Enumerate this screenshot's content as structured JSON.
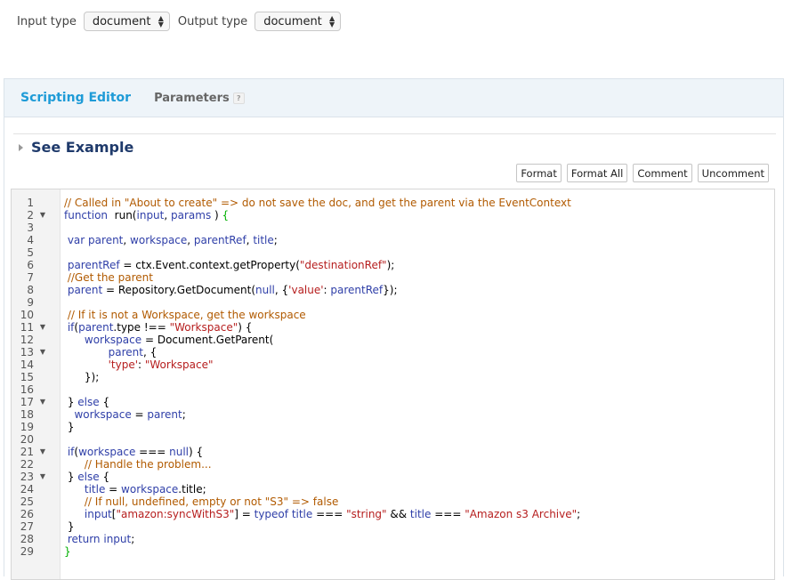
{
  "toolbar": {
    "input_label": "Input type",
    "input_value": "document",
    "output_label": "Output type",
    "output_value": "document"
  },
  "tabs": {
    "active": "Scripting Editor",
    "params": "Parameters",
    "help": "?"
  },
  "example": {
    "label": "See Example"
  },
  "buttons": [
    "Format",
    "Format All",
    "Comment",
    "Uncomment"
  ],
  "gutter": [
    {
      "n": "1",
      "f": false
    },
    {
      "n": "2",
      "f": true
    },
    {
      "n": "3",
      "f": false
    },
    {
      "n": "4",
      "f": false
    },
    {
      "n": "5",
      "f": false
    },
    {
      "n": "6",
      "f": false
    },
    {
      "n": "7",
      "f": false
    },
    {
      "n": "8",
      "f": false
    },
    {
      "n": "9",
      "f": false
    },
    {
      "n": "10",
      "f": false
    },
    {
      "n": "11",
      "f": true
    },
    {
      "n": "12",
      "f": false
    },
    {
      "n": "13",
      "f": true
    },
    {
      "n": "14",
      "f": false
    },
    {
      "n": "15",
      "f": false
    },
    {
      "n": "16",
      "f": false
    },
    {
      "n": "17",
      "f": true
    },
    {
      "n": "18",
      "f": false
    },
    {
      "n": "19",
      "f": false
    },
    {
      "n": "20",
      "f": false
    },
    {
      "n": "21",
      "f": true
    },
    {
      "n": "22",
      "f": false
    },
    {
      "n": "23",
      "f": true
    },
    {
      "n": "24",
      "f": false
    },
    {
      "n": "25",
      "f": false
    },
    {
      "n": "26",
      "f": false
    },
    {
      "n": "27",
      "f": false
    },
    {
      "n": "28",
      "f": false
    },
    {
      "n": "29",
      "f": false
    }
  ],
  "code_lines": [
    [
      [
        "cm",
        "// Called in \"About to create\" => do not save the doc, and get the parent via the EventContext"
      ]
    ],
    [
      [
        "kw",
        "function"
      ],
      [
        "",
        "  run("
      ],
      [
        "kw",
        "input"
      ],
      [
        "",
        ", "
      ],
      [
        "kw",
        "params"
      ],
      [
        "",
        " ) "
      ],
      [
        "brace",
        "{"
      ]
    ],
    [],
    [
      [
        "",
        " "
      ],
      [
        "kw",
        "var"
      ],
      [
        "",
        " "
      ],
      [
        "kw",
        "parent"
      ],
      [
        "",
        ", "
      ],
      [
        "kw",
        "workspace"
      ],
      [
        "",
        ", "
      ],
      [
        "kw",
        "parentRef"
      ],
      [
        "",
        ", "
      ],
      [
        "kw",
        "title"
      ],
      [
        "",
        ";"
      ]
    ],
    [],
    [
      [
        "",
        " "
      ],
      [
        "kw",
        "parentRef"
      ],
      [
        "",
        " = ctx.Event.context.getProperty("
      ],
      [
        "str",
        "\"destinationRef\""
      ],
      [
        "",
        ");"
      ]
    ],
    [
      [
        "",
        " "
      ],
      [
        "cm",
        "//Get the parent"
      ]
    ],
    [
      [
        "",
        " "
      ],
      [
        "kw",
        "parent"
      ],
      [
        "",
        " = Repository.GetDocument("
      ],
      [
        "kw",
        "null"
      ],
      [
        "",
        ", {"
      ],
      [
        "str",
        "'value'"
      ],
      [
        "",
        ": "
      ],
      [
        "kw",
        "parentRef"
      ],
      [
        "",
        "});"
      ]
    ],
    [],
    [
      [
        "",
        " "
      ],
      [
        "cm",
        "// If it is not a Workspace, get the workspace"
      ]
    ],
    [
      [
        "",
        " "
      ],
      [
        "kw",
        "if"
      ],
      [
        "",
        "("
      ],
      [
        "kw",
        "parent"
      ],
      [
        "",
        ".type !== "
      ],
      [
        "str",
        "\"Workspace\""
      ],
      [
        "",
        ") {"
      ]
    ],
    [
      [
        "",
        "      "
      ],
      [
        "kw",
        "workspace"
      ],
      [
        "",
        " = Document.GetParent("
      ]
    ],
    [
      [
        "",
        "             "
      ],
      [
        "kw",
        "parent"
      ],
      [
        "",
        ", {"
      ]
    ],
    [
      [
        "",
        "             "
      ],
      [
        "str",
        "'type'"
      ],
      [
        "",
        ": "
      ],
      [
        "str",
        "\"Workspace\""
      ]
    ],
    [
      [
        "",
        "      });"
      ]
    ],
    [],
    [
      [
        "",
        " } "
      ],
      [
        "kw",
        "else"
      ],
      [
        "",
        " {"
      ]
    ],
    [
      [
        "",
        "   "
      ],
      [
        "kw",
        "workspace"
      ],
      [
        "",
        " = "
      ],
      [
        "kw",
        "parent"
      ],
      [
        "",
        ";"
      ]
    ],
    [
      [
        "",
        " }"
      ]
    ],
    [],
    [
      [
        "",
        " "
      ],
      [
        "kw",
        "if"
      ],
      [
        "",
        "("
      ],
      [
        "kw",
        "workspace"
      ],
      [
        "",
        " === "
      ],
      [
        "kw",
        "null"
      ],
      [
        "",
        ") {"
      ]
    ],
    [
      [
        "",
        "      "
      ],
      [
        "cm",
        "// Handle the problem..."
      ]
    ],
    [
      [
        "",
        " } "
      ],
      [
        "kw",
        "else"
      ],
      [
        "",
        " {"
      ]
    ],
    [
      [
        "",
        "      "
      ],
      [
        "kw",
        "title"
      ],
      [
        "",
        " = "
      ],
      [
        "kw",
        "workspace"
      ],
      [
        "",
        ".title;"
      ]
    ],
    [
      [
        "",
        "      "
      ],
      [
        "cm",
        "// If null, undefined, empty or not \"S3\" => false"
      ]
    ],
    [
      [
        "",
        "      "
      ],
      [
        "kw",
        "input"
      ],
      [
        "",
        "["
      ],
      [
        "str",
        "\"amazon:syncWithS3\""
      ],
      [
        "",
        "] = "
      ],
      [
        "kw",
        "typeof"
      ],
      [
        "",
        " "
      ],
      [
        "kw",
        "title"
      ],
      [
        "",
        " === "
      ],
      [
        "str",
        "\"string\""
      ],
      [
        "",
        " && "
      ],
      [
        "kw",
        "title"
      ],
      [
        "",
        " === "
      ],
      [
        "str",
        "\"Amazon s3 Archive\""
      ],
      [
        "",
        ";"
      ]
    ],
    [
      [
        "",
        " }"
      ]
    ],
    [
      [
        "",
        " "
      ],
      [
        "kw",
        "return"
      ],
      [
        "",
        " "
      ],
      [
        "kw",
        "input"
      ],
      [
        "",
        ";"
      ]
    ],
    [
      [
        "brace",
        "}"
      ]
    ]
  ]
}
